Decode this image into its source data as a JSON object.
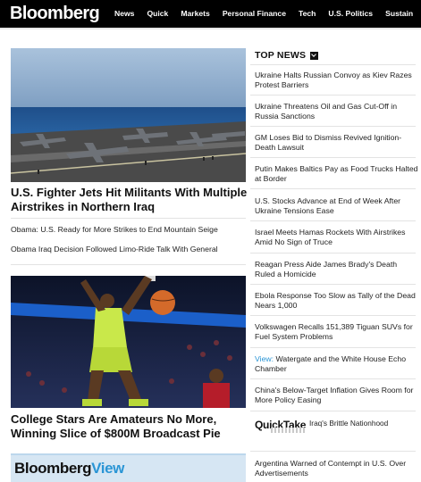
{
  "brand": {
    "logo": "Bloomberg"
  },
  "nav": {
    "items": [
      "News",
      "Quick",
      "Markets",
      "Personal Finance",
      "Tech",
      "U.S. Politics",
      "Sustain"
    ]
  },
  "main": {
    "hero1": {
      "title": "U.S. Fighter Jets Hit Militants With Multiple Airstrikes in Northern Iraq"
    },
    "related": [
      "Obama: U.S. Ready for More Strikes to End Mountain Seige",
      "Obama Iraq Decision Followed Limo-Ride Talk With General"
    ],
    "hero2": {
      "title": "College Stars Are Amateurs No More, Winning Slice of $800M Broadcast Pie"
    },
    "view": {
      "brand": "Bloomberg",
      "brand_accent": "View"
    }
  },
  "top_news": {
    "heading": "TOP NEWS",
    "stories": [
      {
        "text": "Ukraine Halts Russian Convoy as Kiev Razes Protest Barriers"
      },
      {
        "text": "Ukraine Threatens Oil and Gas Cut-Off in Russia Sanctions"
      },
      {
        "text": "GM Loses Bid to Dismiss Revived Ignition-Death Lawsuit"
      },
      {
        "text": "Putin Makes Baltics Pay as Food Trucks Halted at Border"
      },
      {
        "text": "U.S. Stocks Advance at End of Week After Ukraine Tensions Ease"
      },
      {
        "text": "Israel Meets Hamas Rockets With Airstrikes Amid No Sign of Truce"
      },
      {
        "text": "Reagan Press Aide James Brady's Death Ruled a Homicide"
      },
      {
        "text": "Ebola Response Too Slow as Tally of the Dead Nears 1,000"
      },
      {
        "text": "Volkswagen Recalls 151,389 Tiguan SUVs for Fuel System Problems"
      },
      {
        "label": "View:",
        "text": "Watergate and the White House Echo Chamber"
      },
      {
        "text": "China's Below-Target Inflation Gives Room for More Policy Easing"
      }
    ],
    "quicktake": {
      "logo": "QuickTake",
      "text": "Iraq's Brittle Nationhood"
    },
    "last_story": "Argentina Warned of Contempt in U.S. Over Advertisements"
  }
}
